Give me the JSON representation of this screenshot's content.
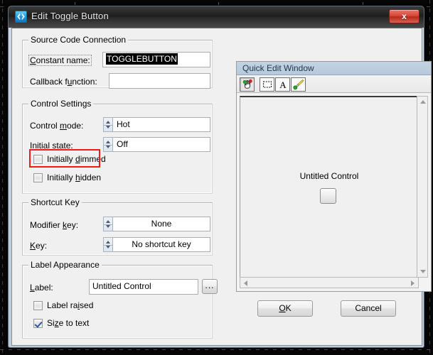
{
  "window": {
    "title": "Edit Toggle Button",
    "icon": "code-brackets-icon",
    "close_label": "x"
  },
  "source_code_connection": {
    "legend": "Source Code Connection",
    "constant_name": {
      "label_prefix": "C",
      "label_rest": "onstant name:",
      "label_full": "Constant name:",
      "value": "TOGGLEBUTTON",
      "selected": true
    },
    "callback_function": {
      "label_pre": "Callback f",
      "label_acc": "u",
      "label_post": "nction:",
      "label_full": "Callback function:",
      "value": "",
      "placeholder": ""
    }
  },
  "control_settings": {
    "legend": "Control Settings",
    "control_mode": {
      "label_pre": "Control ",
      "label_acc": "m",
      "label_post": "ode:",
      "label_full": "Control mode:",
      "value": "Hot"
    },
    "initial_state": {
      "label_pre": "",
      "label_acc": "I",
      "label_post": "nitial state:",
      "label_full": "Initial state:",
      "value": "Off"
    },
    "initially_dimmed": {
      "label_pre": "Initially ",
      "label_acc": "d",
      "label_post": "immed",
      "label_full": "Initially dimmed",
      "checked": false,
      "highlighted": true,
      "highlight_color": "#ee1b1b"
    },
    "initially_hidden": {
      "label_pre": "Initially ",
      "label_acc": "h",
      "label_post": "idden",
      "label_full": "Initially hidden",
      "checked": false
    }
  },
  "shortcut_key": {
    "legend": "Shortcut Key",
    "modifier_key": {
      "label_pre": "Modifier ",
      "label_acc": "k",
      "label_post": "ey:",
      "label_full": "Modifier key:",
      "value": "None"
    },
    "key": {
      "label_pre": "",
      "label_acc": "K",
      "label_post": "ey:",
      "label_full": "Key:",
      "value": "No shortcut key"
    }
  },
  "label_appearance": {
    "legend": "Label Appearance",
    "label_field": {
      "label_pre": "",
      "label_acc": "L",
      "label_post": "abel:",
      "label_full": "Label:",
      "value": "Untitled Control"
    },
    "browse_button": "...",
    "label_raised": {
      "label_pre": "Label ra",
      "label_acc": "i",
      "label_post": "sed",
      "label_full": "Label raised",
      "checked": false
    },
    "size_to_text": {
      "label_pre": "Si",
      "label_acc": "z",
      "label_post": "e to text",
      "label_full": "Size to text",
      "checked": true
    }
  },
  "quick_edit_window": {
    "title": "Quick Edit Window",
    "toolbar": [
      {
        "name": "pointer-hand-icon",
        "state": "pressed"
      },
      {
        "name": "select-rectangle-icon",
        "state": "outlined"
      },
      {
        "name": "text-tool-icon",
        "state": "outlined"
      },
      {
        "name": "paintbrush-icon",
        "state": "outlined"
      }
    ],
    "canvas": {
      "control_label": "Untitled Control",
      "control_type": "toggle-button"
    }
  },
  "actions": {
    "ok_pre": "O",
    "ok_post": "K",
    "ok_full": "OK",
    "cancel": "Cancel"
  }
}
